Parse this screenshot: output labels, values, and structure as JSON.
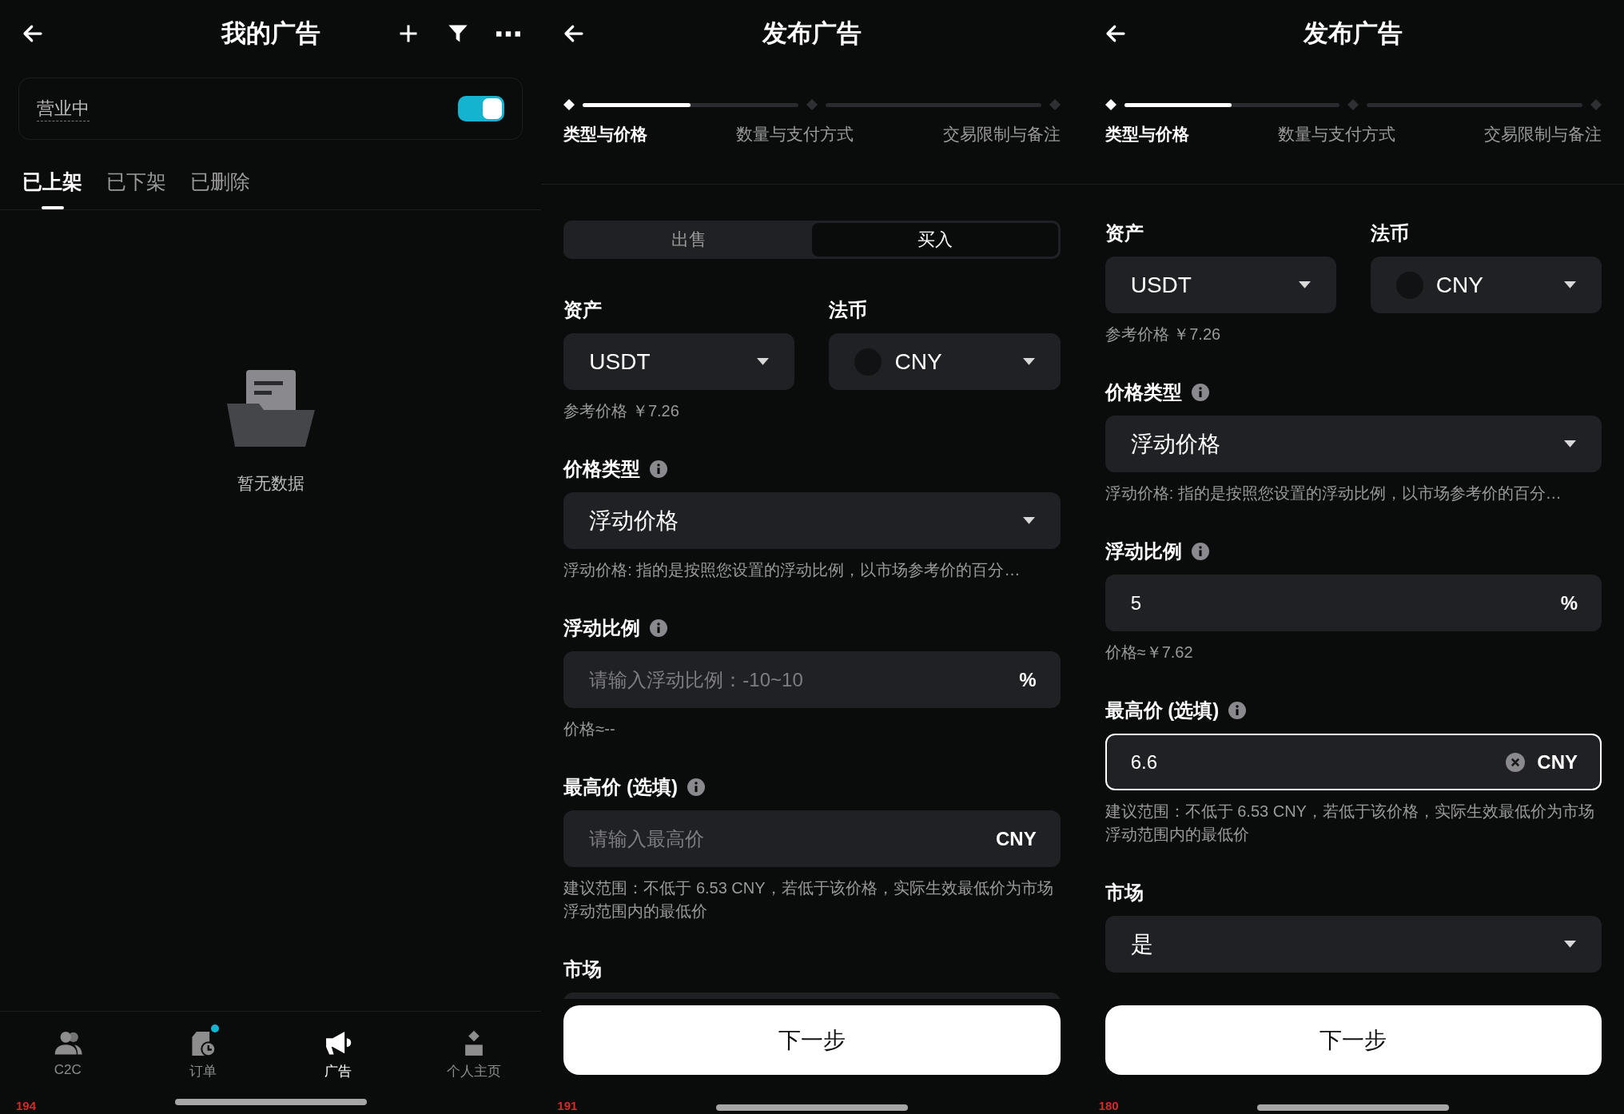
{
  "screens": [
    {
      "kind": "list",
      "header": {
        "title": "我的广告"
      },
      "status": {
        "label": "营业中",
        "on": true
      },
      "tabs": [
        {
          "label": "已上架",
          "selected": true
        },
        {
          "label": "已下架",
          "selected": false
        },
        {
          "label": "已删除",
          "selected": false
        }
      ],
      "empty": {
        "text": "暂无数据"
      },
      "nav": [
        {
          "label": "C2C",
          "selected": false,
          "badge": false
        },
        {
          "label": "订单",
          "selected": false,
          "badge": true
        },
        {
          "label": "广告",
          "selected": true,
          "badge": false
        },
        {
          "label": "个人主页",
          "selected": false,
          "badge": false
        }
      ],
      "overlay_number": "194"
    },
    {
      "kind": "form",
      "header": {
        "title": "发布广告"
      },
      "steps": [
        {
          "label": "类型与价格",
          "selected": true,
          "level": 0.5
        },
        {
          "label": "数量与支付方式",
          "selected": false,
          "level": 0
        },
        {
          "label": "交易限制与备注",
          "selected": false
        }
      ],
      "side_switch": [
        {
          "label": "出售",
          "selected": false
        },
        {
          "label": "买入",
          "selected": true
        }
      ],
      "fields": [
        {
          "kind": "pair",
          "items": [
            {
              "label": "资产",
              "value": "USDT",
              "coin_icon": false
            },
            {
              "label": "法币",
              "value": "CNY",
              "coin_icon": true
            }
          ],
          "note": "参考价格 ￥7.26"
        },
        {
          "kind": "select",
          "label": "价格类型",
          "info": true,
          "value": "浮动价格",
          "note": "浮动价格: 指的是按照您设置的浮动比例，以市场参考价的百分…"
        },
        {
          "kind": "input",
          "label": "浮动比例",
          "info": true,
          "placeholder": "请输入浮动比例：-10~10",
          "suffix": "%",
          "focused": false,
          "note": "价格≈--"
        },
        {
          "kind": "input",
          "label": "最高价 (选填)",
          "info": true,
          "placeholder": "请输入最高价",
          "suffix": "CNY",
          "focused": false,
          "note": "建议范围：不低于 6.53 CNY，若低于该价格，实际生效最低价为市场浮动范围内的最低价"
        },
        {
          "kind": "select",
          "label": "市场",
          "info": false
        }
      ],
      "next_button": "下一步",
      "overlay_number": "191"
    },
    {
      "kind": "form",
      "header": {
        "title": "发布广告"
      },
      "steps": [
        {
          "label": "类型与价格",
          "selected": true,
          "level": 0.5
        },
        {
          "label": "数量与支付方式",
          "selected": false,
          "level": 0
        },
        {
          "label": "交易限制与备注",
          "selected": false
        }
      ],
      "fields": [
        {
          "kind": "pair",
          "items": [
            {
              "label": "资产",
              "value": "USDT",
              "coin_icon": false
            },
            {
              "label": "法币",
              "value": "CNY",
              "coin_icon": true
            }
          ],
          "note": "参考价格 ￥7.26"
        },
        {
          "kind": "select",
          "label": "价格类型",
          "info": true,
          "value": "浮动价格",
          "note": "浮动价格: 指的是按照您设置的浮动比例，以市场参考价的百分…"
        },
        {
          "kind": "input",
          "label": "浮动比例",
          "info": true,
          "value": "5",
          "suffix": "%",
          "focused": false,
          "note": "价格≈￥7.62"
        },
        {
          "kind": "input",
          "label": "最高价 (选填)",
          "info": true,
          "value": "6.6",
          "suffix": "CNY",
          "focused": true,
          "note": "建议范围：不低于 6.53 CNY，若低于该价格，实际生效最低价为市场浮动范围内的最低价"
        },
        {
          "kind": "select",
          "label": "市场",
          "info": false,
          "value": "是"
        }
      ],
      "next_button": "下一步",
      "overlay_number": "180"
    }
  ]
}
